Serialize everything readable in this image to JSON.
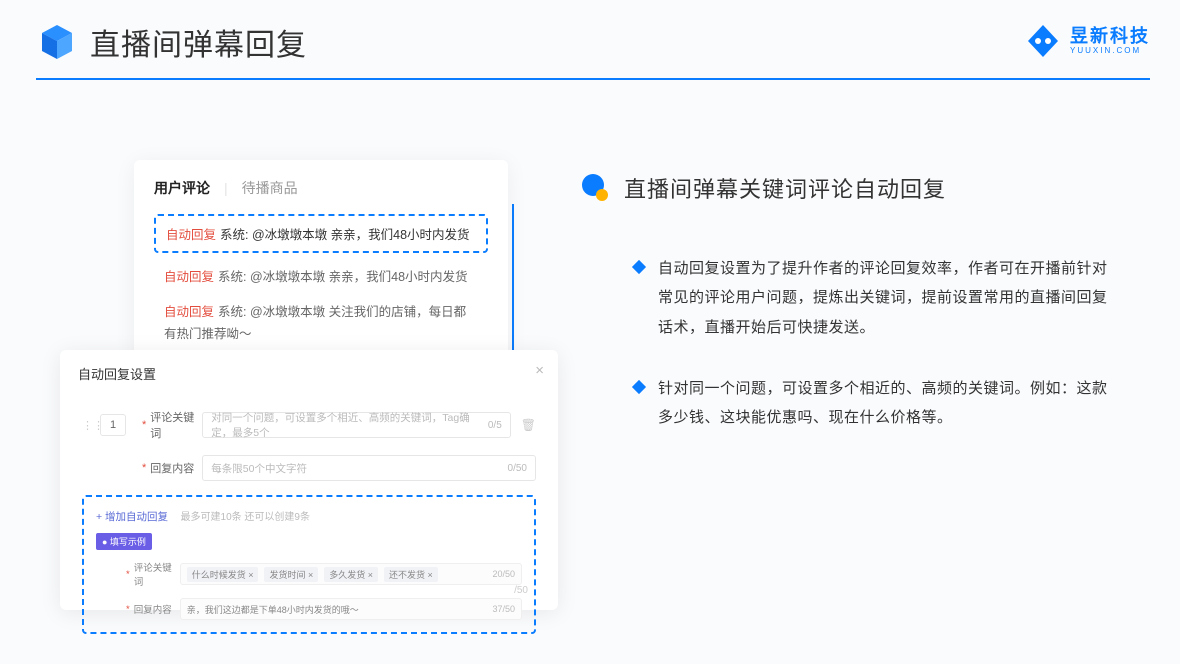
{
  "header": {
    "title": "直播间弹幕回复",
    "brand_cn": "昱新科技",
    "brand_en": "YUUXIN.COM"
  },
  "right": {
    "subtitle": "直播间弹幕关键词评论自动回复",
    "bullets": [
      "自动回复设置为了提升作者的评论回复效率，作者可在开播前针对常见的评论用户问题，提炼出关键词，提前设置常用的直播间回复话术，直播开始后可快捷发送。",
      "针对同一个问题，可设置多个相近的、高频的关键词。例如：这款多少钱、这块能优惠吗、现在什么价格等。"
    ]
  },
  "card_top": {
    "tab_active": "用户评论",
    "tab_inactive": "待播商品",
    "auto_tag": "自动回复",
    "highlighted": "系统: @冰墩墩本墩 亲亲，我们48小时内发货",
    "rows": [
      "系统: @冰墩墩本墩 亲亲，我们48小时内发货",
      "系统: @冰墩墩本墩 关注我们的店铺，每日都有热门推荐呦～"
    ]
  },
  "card_bottom": {
    "title": "自动回复设置",
    "num": "1",
    "kw_label": "评论关键词",
    "kw_placeholder": "对同一个问题，可设置多个相近、高频的关键词，Tag确定，最多5个",
    "kw_count": "0/5",
    "content_label": "回复内容",
    "content_placeholder": "每条限50个中文字符",
    "content_count": "0/50",
    "add_link": "+ 增加自动回复",
    "add_hint": "最多可建10条 还可以创建9条",
    "example_badge": "● 填写示例",
    "ex_kw_label": "评论关键词",
    "ex_tags": [
      "什么时候发货 ×",
      "发货时间 ×",
      "多久发货 ×",
      "还不发货 ×"
    ],
    "ex_kw_count": "20/50",
    "ex_content_label": "回复内容",
    "ex_content_text": "亲，我们这边都是下单48小时内发货的哦～",
    "ex_content_count": "37/50",
    "partial_count": "/50"
  }
}
